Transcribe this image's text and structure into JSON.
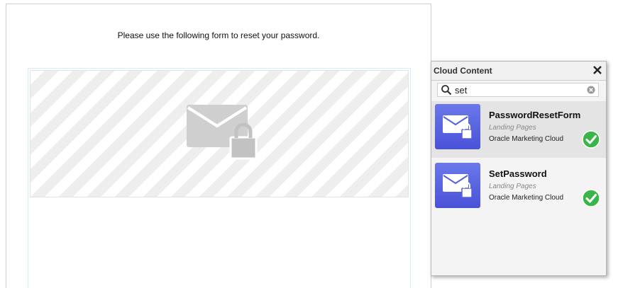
{
  "canvas": {
    "intro_text": "Please use the following form to reset your password."
  },
  "panel": {
    "title": "Cloud Content",
    "close_icon": "close-icon",
    "search": {
      "value": "set",
      "icon": "search-icon",
      "clear_icon": "clear-icon"
    },
    "results": [
      {
        "name": "PasswordResetForm",
        "type": "Landing Pages",
        "source": "Oracle Marketing Cloud",
        "selected": true,
        "thumbnail_icon": "envelope-lock-icon",
        "status_icon": "check-icon"
      },
      {
        "name": "SetPassword",
        "type": "Landing Pages",
        "source": "Oracle Marketing Cloud",
        "selected": false,
        "thumbnail_icon": "envelope-lock-icon",
        "status_icon": "check-icon"
      }
    ]
  },
  "colors": {
    "accent_thumb": "#5560e0",
    "check_green": "#3bb54a"
  }
}
